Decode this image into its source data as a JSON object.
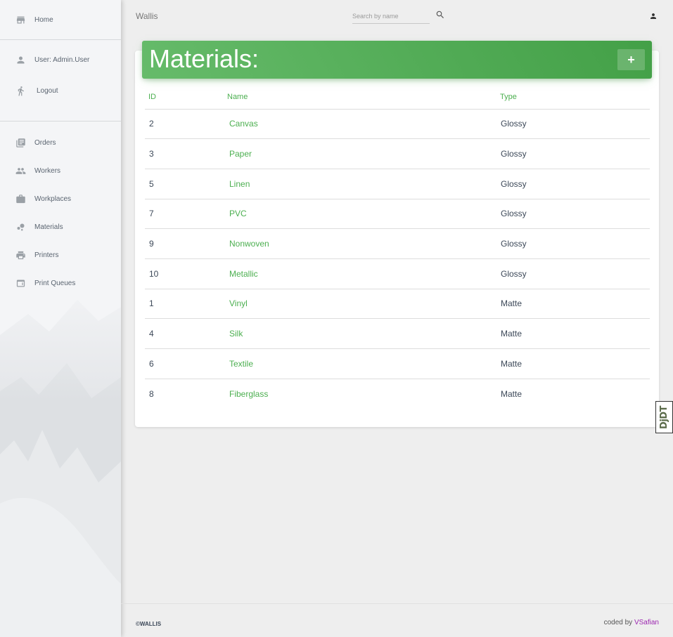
{
  "sidebar": {
    "top_items": [
      {
        "label": "Home",
        "icon": "store-icon"
      }
    ],
    "user_items": [
      {
        "label": "User: Admin.User",
        "icon": "person-icon"
      },
      {
        "label": "Logout",
        "icon": "run-icon"
      }
    ],
    "nav_items": [
      {
        "label": "Orders",
        "icon": "library-books-icon"
      },
      {
        "label": "Workers",
        "icon": "people-icon"
      },
      {
        "label": "Workplaces",
        "icon": "work-briefcase-icon"
      },
      {
        "label": "Materials",
        "icon": "bubble-chart-icon"
      },
      {
        "label": "Printers",
        "icon": "printer-icon"
      },
      {
        "label": "Print Queues",
        "icon": "window-icon"
      }
    ]
  },
  "topbar": {
    "brand": "Wallis",
    "search_placeholder": "Search by name",
    "search_icon": "search-icon",
    "user_icon": "person-icon"
  },
  "card": {
    "title": "Materials:",
    "add_label": "+",
    "columns": [
      "ID",
      "Name",
      "Type"
    ],
    "rows": [
      {
        "id": "2",
        "name": "Canvas",
        "type": "Glossy"
      },
      {
        "id": "3",
        "name": "Paper",
        "type": "Glossy"
      },
      {
        "id": "5",
        "name": "Linen",
        "type": "Glossy"
      },
      {
        "id": "7",
        "name": "PVC",
        "type": "Glossy"
      },
      {
        "id": "9",
        "name": "Nonwoven",
        "type": "Glossy"
      },
      {
        "id": "10",
        "name": "Metallic",
        "type": "Glossy"
      },
      {
        "id": "1",
        "name": "Vinyl",
        "type": "Matte"
      },
      {
        "id": "4",
        "name": "Silk",
        "type": "Matte"
      },
      {
        "id": "6",
        "name": "Textile",
        "type": "Matte"
      },
      {
        "id": "8",
        "name": "Fiberglass",
        "type": "Matte"
      }
    ]
  },
  "footer": {
    "copyright": "©WALLIS",
    "credit_prefix": "coded by ",
    "credit_author": "VSafian"
  },
  "debug_badge": "DjDT",
  "colors": {
    "accent_green": "#4caf50",
    "header_gradient_start": "#66bb6a",
    "header_gradient_end": "#43a047",
    "credit_link": "#9c27b0"
  }
}
